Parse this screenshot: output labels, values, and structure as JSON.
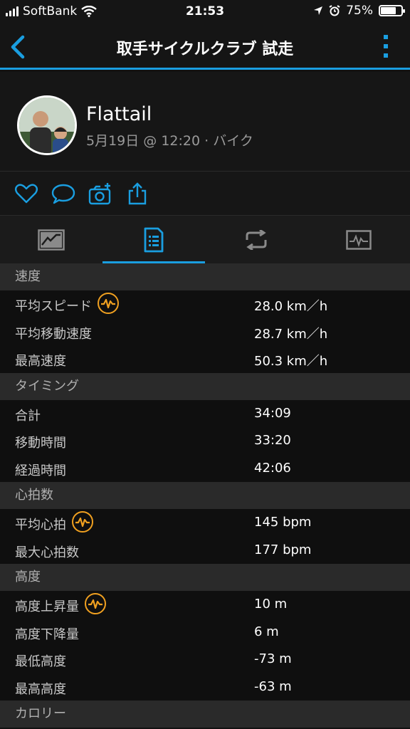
{
  "status": {
    "carrier": "SoftBank",
    "time": "21:53",
    "battery_pct": "75%",
    "battery_level": 0.75
  },
  "nav": {
    "title": "取手サイクルクラブ 試走"
  },
  "profile": {
    "name": "Flattail",
    "meta": "5月19日 @ 12:20 · バイク"
  },
  "actions": [
    "like-icon",
    "comment-icon",
    "add-photo-icon",
    "share-icon"
  ],
  "tabs": [
    {
      "icon": "summary-chart-icon",
      "active": false
    },
    {
      "icon": "stats-list-icon",
      "active": true
    },
    {
      "icon": "laps-icon",
      "active": false
    },
    {
      "icon": "graph-icon",
      "active": false
    }
  ],
  "sections": [
    {
      "title": "速度",
      "rows": [
        {
          "label": "平均スピード",
          "value": "28.0 km／h",
          "badge": true
        },
        {
          "label": "平均移動速度",
          "value": "28.7 km／h",
          "badge": false
        },
        {
          "label": "最高速度",
          "value": "50.3 km／h",
          "badge": false
        }
      ]
    },
    {
      "title": "タイミング",
      "rows": [
        {
          "label": "合計",
          "value": "34:09",
          "badge": false
        },
        {
          "label": "移動時間",
          "value": "33:20",
          "badge": false
        },
        {
          "label": "経過時間",
          "value": "42:06",
          "badge": false
        }
      ]
    },
    {
      "title": "心拍数",
      "rows": [
        {
          "label": "平均心拍",
          "value": "145 bpm",
          "badge": true
        },
        {
          "label": "最大心拍数",
          "value": "177 bpm",
          "badge": false
        }
      ]
    },
    {
      "title": "高度",
      "rows": [
        {
          "label": "高度上昇量",
          "value": "10 m",
          "badge": true
        },
        {
          "label": "高度下降量",
          "value": "6 m",
          "badge": false
        },
        {
          "label": "最低高度",
          "value": "-73 m",
          "badge": false
        },
        {
          "label": "最高高度",
          "value": "-63 m",
          "badge": false
        }
      ]
    },
    {
      "title": "カロリー",
      "rows": []
    }
  ],
  "colors": {
    "accent": "#1a9ee0",
    "badge": "#f0a020"
  }
}
